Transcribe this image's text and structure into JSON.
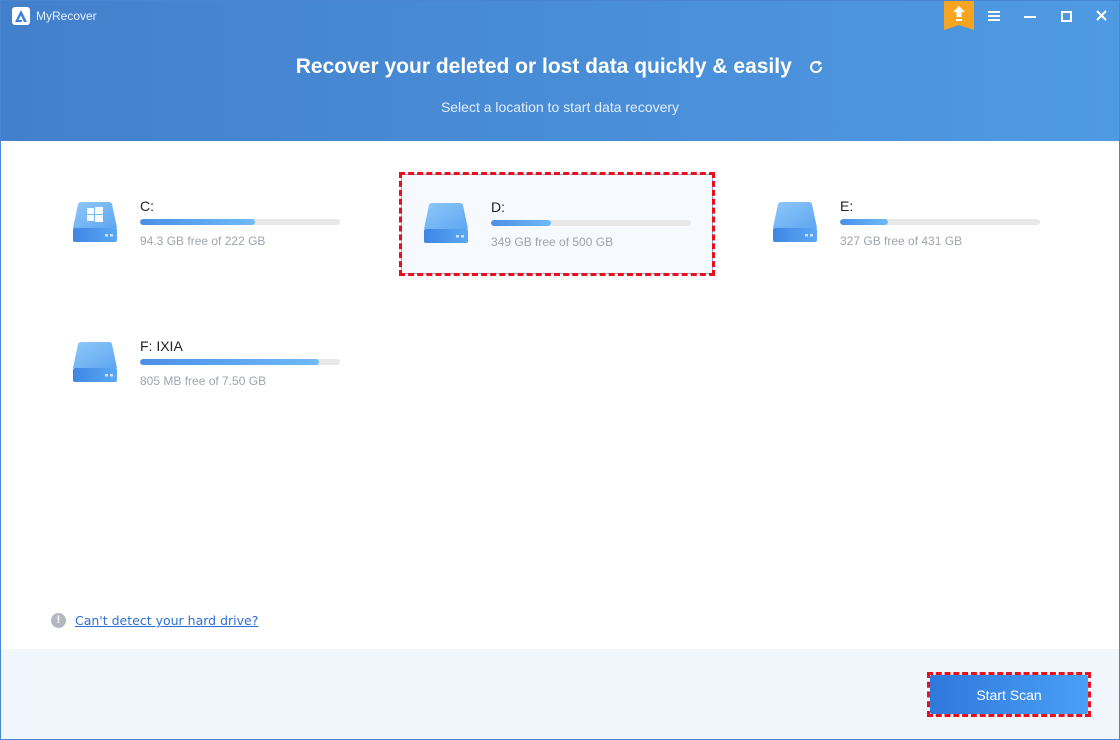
{
  "app": {
    "title": "MyRecover",
    "icons": {
      "logo": "myrecover-logo-icon",
      "upgrade": "upgrade-arrow-icon",
      "menu": "hamburger-menu-icon",
      "minimize": "minimize-icon",
      "maximize": "maximize-icon",
      "close": "close-icon"
    }
  },
  "header": {
    "headline": "Recover your deleted or lost data quickly & easily",
    "subline": "Select a location to start data recovery",
    "refresh_icon": "refresh-icon"
  },
  "drives": [
    {
      "name": "C:",
      "info": "94.3 GB free of 222 GB",
      "used_fraction": 0.575,
      "icon": "windows-drive-icon",
      "selected": false
    },
    {
      "name": "D:",
      "info": "349 GB free of 500 GB",
      "used_fraction": 0.302,
      "icon": "hard-drive-icon",
      "selected": true
    },
    {
      "name": "E:",
      "info": "327 GB free of 431 GB",
      "used_fraction": 0.241,
      "icon": "hard-drive-icon",
      "selected": false
    },
    {
      "name": "F: IXIA",
      "info": "805 MB free of 7.50 GB",
      "used_fraction": 0.895,
      "icon": "hard-drive-icon",
      "selected": false
    }
  ],
  "help": {
    "icon": "exclamation-info-icon",
    "link_text": "Can't detect your hard drive?"
  },
  "footer": {
    "start_scan_label": "Start Scan"
  },
  "colors": {
    "header_blue": "#4a8fd9",
    "accent_blue": "#2f78dc",
    "upgrade_orange": "#f7a520",
    "highlight_red": "#e8101c",
    "link_blue": "#2d6fd6"
  }
}
